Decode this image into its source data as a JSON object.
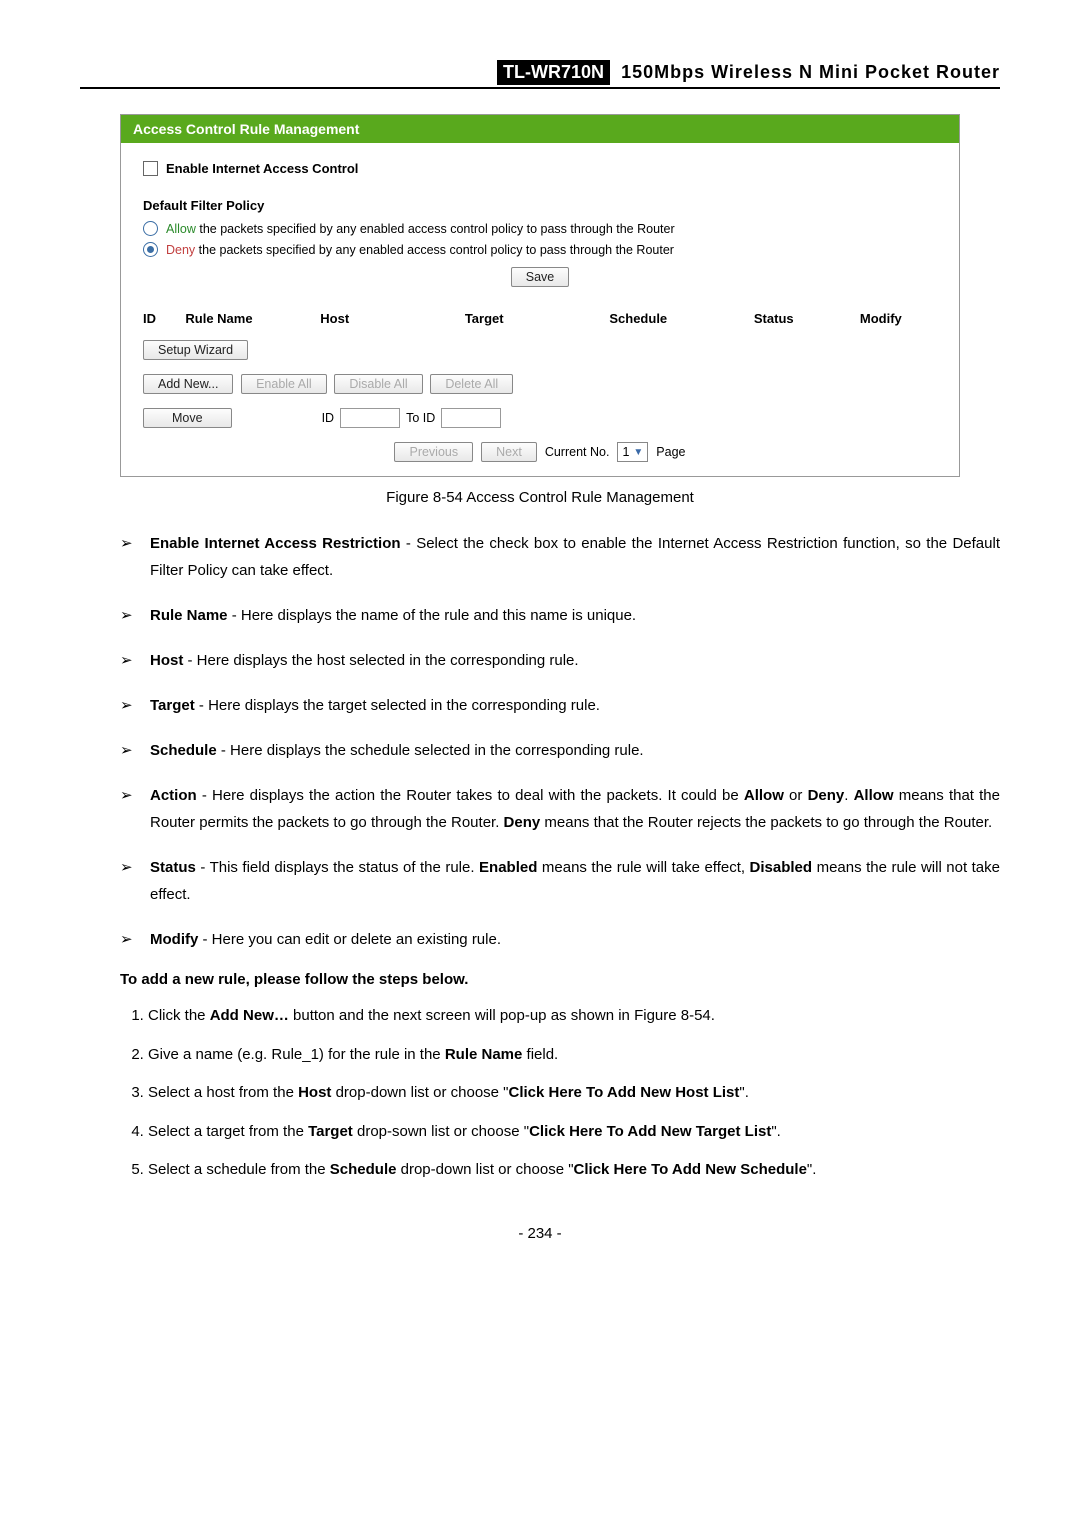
{
  "header": {
    "model": "TL-WR710N",
    "desc": "150Mbps  Wireless  N  Mini  Pocket  Router"
  },
  "screenshot": {
    "title": "Access Control Rule Management",
    "enable_checkbox_label": "Enable Internet Access Control",
    "default_filter_title": "Default Filter Policy",
    "allow_word": "Allow",
    "allow_rest": " the packets specified by any enabled access control policy to pass through the Router",
    "deny_word": "Deny",
    "deny_rest": " the packets specified by any enabled access control policy to pass through the Router",
    "save_btn": "Save",
    "table_headers": {
      "id": "ID",
      "rule": "Rule Name",
      "host": "Host",
      "target": "Target",
      "schedule": "Schedule",
      "status": "Status",
      "modify": "Modify"
    },
    "setup_wizard": "Setup Wizard",
    "add_new": "Add New...",
    "enable_all": "Enable All",
    "disable_all": "Disable All",
    "delete_all": "Delete All",
    "move": "Move",
    "id_label": "ID",
    "to_id_label": "To ID",
    "previous": "Previous",
    "next": "Next",
    "current_no": "Current No.",
    "page_select_value": "1",
    "page_word": "Page"
  },
  "caption": "Figure 8-54    Access Control Rule Management",
  "bullets": [
    {
      "b": "Enable Internet Access Restriction",
      "rest": " - Select the check box to enable the Internet Access Restriction function, so the Default Filter Policy can take effect."
    },
    {
      "b": "Rule Name",
      "rest": " - Here displays the name of the rule and this name is unique."
    },
    {
      "b": "Host",
      "rest": " - Here displays the host selected in the corresponding rule."
    },
    {
      "b": "Target",
      "rest": " - Here displays the target selected in the corresponding rule."
    },
    {
      "b": "Schedule",
      "rest": " - Here displays the schedule selected in the corresponding rule."
    }
  ],
  "bullet_action": {
    "b1": "Action",
    "t1": " - Here displays the action the Router takes to deal with the packets. It could be ",
    "b2": "Allow",
    "t2": " or ",
    "b3": "Deny",
    "t3": ". ",
    "b4": "Allow",
    "t4": " means that the Router permits the packets to go through the Router. ",
    "b5": "Deny",
    "t5": " means that the Router rejects the packets to go through the Router."
  },
  "bullet_status": {
    "b1": "Status",
    "t1": " - This field displays the status of the rule. ",
    "b2": "Enabled",
    "t2": " means the rule will take effect, ",
    "b3": "Disabled",
    "t3": " means the rule will not take effect."
  },
  "bullet_modify": {
    "b": "Modify",
    "rest": " - Here you can edit or delete an existing rule."
  },
  "steps_title": "To add a new rule, please follow the steps below.",
  "steps": {
    "s1a": "Click the ",
    "s1b": "Add New…",
    "s1c": " button and the next screen will pop-up as shown in Figure 8-54.",
    "s2a": "Give a name (e.g. Rule_1) for the rule in the ",
    "s2b": "Rule Name",
    "s2c": " field.",
    "s3a": "Select a host from the ",
    "s3b": "Host",
    "s3c": " drop-down list or choose \"",
    "s3d": "Click Here To Add New Host List",
    "s3e": "\".",
    "s4a": "Select a target from the ",
    "s4b": "Target",
    "s4c": " drop-sown list or choose \"",
    "s4d": "Click Here To Add New Target List",
    "s4e": "\".",
    "s5a": "Select a schedule from the ",
    "s5b": "Schedule",
    "s5c": " drop-down list or choose \"",
    "s5d": "Click Here To Add New Schedule",
    "s5e": "\"."
  },
  "page_number": "- 234 -"
}
